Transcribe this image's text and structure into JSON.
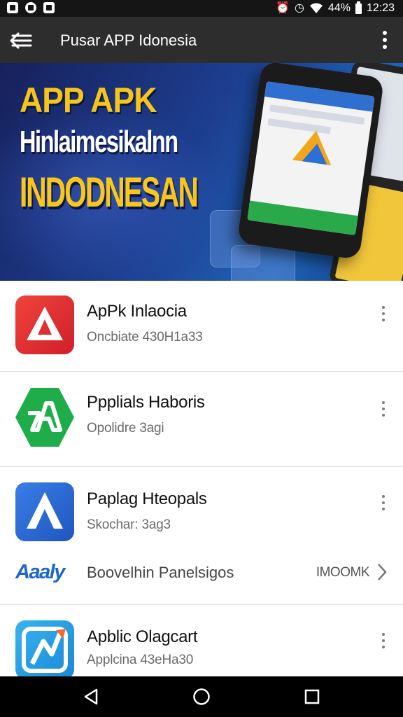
{
  "status_bar": {
    "battery": "44%",
    "time": "12:23",
    "left_icons": [
      "notification-app-icon",
      "notification-drop-icon",
      "notification-lock-icon"
    ],
    "right_icons": [
      "alarm-icon",
      "clock-icon",
      "wifi-icon",
      "battery-icon"
    ]
  },
  "app_bar": {
    "title": "Pusar APP Idonesia",
    "nav_icon": "menu-back-icon",
    "overflow_icon": "more-vert-icon"
  },
  "banner": {
    "line1": "APP APK",
    "line2": "Hinlaimesikalnn",
    "line3": "INDODNESAN"
  },
  "apps": [
    {
      "name": "ApPk Inlaocia",
      "subtitle": "Oncbiate 430H1a33",
      "icon": "red-a-app-icon",
      "color": "#e53935"
    },
    {
      "name": "Ppplials Haboris",
      "subtitle": "Opolidre 3agi",
      "icon": "green-a-app-icon",
      "color": "#1fad4a"
    },
    {
      "name": "Paplag Hteopals",
      "subtitle": "Skochar: 3ag3",
      "icon": "blue-a-app-icon",
      "color": "#2f6fd6"
    },
    {
      "name": "Apblic Olagcart",
      "subtitle": "Applcina 43eHa30",
      "icon": "cyan-arrow-app-icon",
      "color": "#1d9be0"
    }
  ],
  "promo": {
    "logo": "Aaaly",
    "text": "Boovelhin Panelsigos",
    "action": "IMOOMK"
  },
  "nav_bar": {
    "back_icon": "back-triangle-icon",
    "home_icon": "home-circle-icon",
    "recents_icon": "recents-square-icon"
  }
}
